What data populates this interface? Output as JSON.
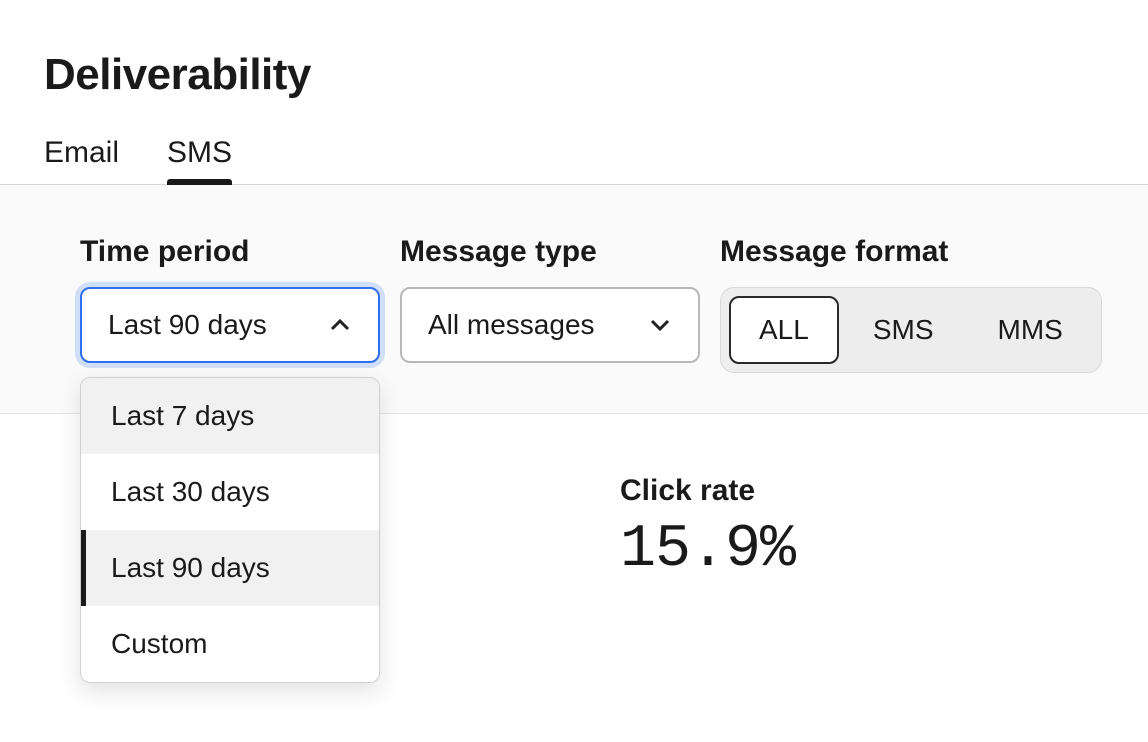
{
  "header": {
    "title": "Deliverability"
  },
  "tabs": {
    "email": "Email",
    "sms": "SMS",
    "active": "sms"
  },
  "filters": {
    "time_period": {
      "label": "Time period",
      "selected": "Last 90 days",
      "options": [
        "Last 7 days",
        "Last 30 days",
        "Last 90 days",
        "Custom"
      ]
    },
    "message_type": {
      "label": "Message type",
      "selected": "All messages"
    },
    "message_format": {
      "label": "Message format",
      "options": [
        "ALL",
        "SMS",
        "MMS"
      ],
      "selected": "ALL"
    }
  },
  "stats": {
    "click_rate": {
      "label": "Click rate",
      "value": "15.9%"
    }
  }
}
